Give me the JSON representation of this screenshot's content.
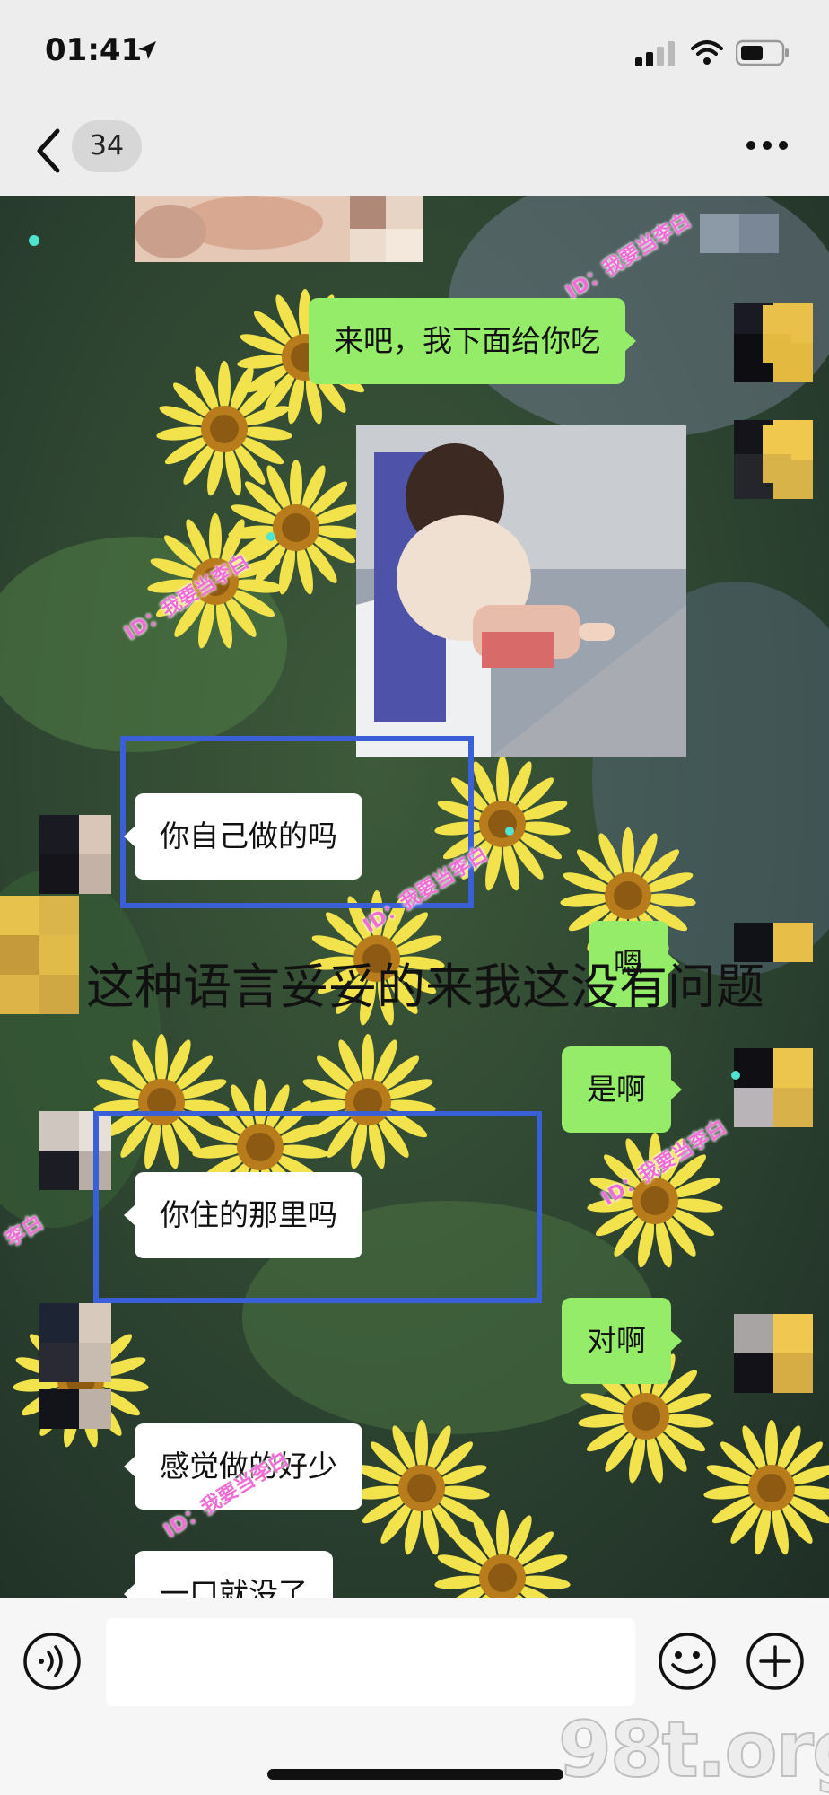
{
  "status_bar": {
    "time": "01:41"
  },
  "nav": {
    "unread_count": "34"
  },
  "messages": {
    "m1": "来吧，我下面给你吃",
    "m2": "你自己做的吗",
    "m3": "嗯",
    "m4": "是啊",
    "m5": "你住的那里吗",
    "m6": "对啊",
    "m7": "感觉做的好少",
    "m8": "一口就没了"
  },
  "overlay_caption": "这种语言妥妥的来我这没有问题",
  "watermarks": {
    "tag": "ID：我要当李白",
    "tag_partial": "李白",
    "site": "98t.org"
  },
  "colors": {
    "sent_bubble": "#95ec69",
    "received_bubble": "#ffffff",
    "highlight_box": "#3a5fd6",
    "watermark_text": "#f06fd5"
  }
}
